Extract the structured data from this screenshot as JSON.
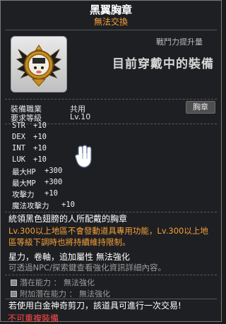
{
  "item": {
    "name": "黑翼胸章",
    "trade_status": "無法交換",
    "power_label": "戰鬥力提升量",
    "compare_text": "目前穿戴中的裝備",
    "slot_badge": "胸章"
  },
  "requirements": {
    "job_label": "裝備職業",
    "job_value": "共用",
    "level_label": "要求等級",
    "level_value": "Lv.10"
  },
  "stats": [
    {
      "name": "STR",
      "value": "+10"
    },
    {
      "name": "DEX",
      "value": "+10"
    },
    {
      "name": "INT",
      "value": "+10"
    },
    {
      "name": "LUK",
      "value": "+10"
    },
    {
      "name": "最大HP",
      "value": "+300"
    },
    {
      "name": "最大MP",
      "value": "+300"
    },
    {
      "name": "攻擊力",
      "value": "+10"
    },
    {
      "name": "魔法攻擊力",
      "value": "+10"
    }
  ],
  "description": {
    "flavor": "統領黑色翅膀的人所配戴的胸章",
    "line2_hl": "Lv.300以上地區不會發動道具專用功能，Lv.300以上地",
    "line3_hl": "區等級下調時也將持續維持限制。",
    "enhance": "星力，卷軸，追加屬性 無法強化",
    "enhance_note": "可透過NPC/探索鍵查看強化資訊詳細內容。"
  },
  "potential": {
    "potential_row": "潛在能力 ： 無法強化",
    "additional_row": "附加潛在能力 ： 無法強化"
  },
  "footer": {
    "scissors_note": "若使用白金神奇剪刀，該道具可進行一次交易!",
    "no_duplicate": "不可重複裝備"
  },
  "colors": {
    "accent_orange": "#f7a13b",
    "warning_red": "#ff4a4a",
    "panel_bg": "#1e1f22"
  }
}
